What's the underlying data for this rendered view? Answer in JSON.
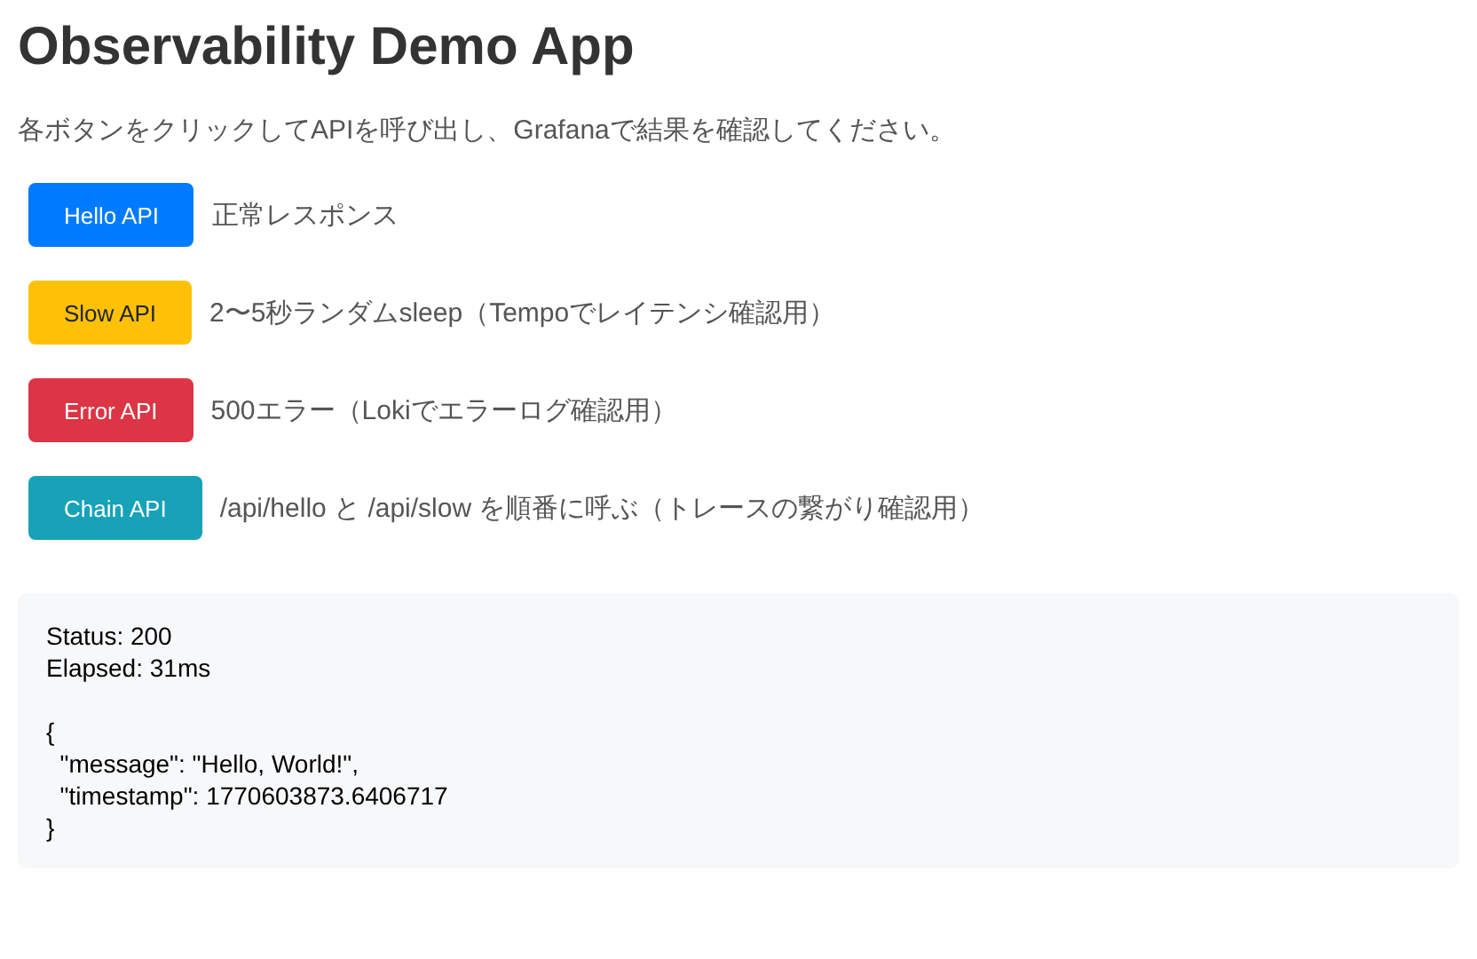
{
  "title": "Observability Demo App",
  "intro": "各ボタンをクリックしてAPIを呼び出し、Grafanaで結果を確認してください。",
  "actions": [
    {
      "button": "Hello API",
      "color": "#007bff",
      "description": "正常レスポンス"
    },
    {
      "button": "Slow API",
      "color": "#ffc107",
      "description": "2〜5秒ランダムsleep（Tempoでレイテンシ確認用）"
    },
    {
      "button": "Error API",
      "color": "#dc3545",
      "description": "500エラー（Lokiでエラーログ確認用）"
    },
    {
      "button": "Chain API",
      "color": "#17a2b8",
      "description": "/api/hello と /api/slow を順番に呼ぶ（トレースの繋がり確認用）"
    }
  ],
  "result": {
    "meta": [
      "Status: 200",
      "Elapsed: 31ms"
    ],
    "body": [
      "{",
      "  \"message\": \"Hello, World!\",",
      "  \"timestamp\": 1770603873.6406717",
      "}"
    ]
  }
}
